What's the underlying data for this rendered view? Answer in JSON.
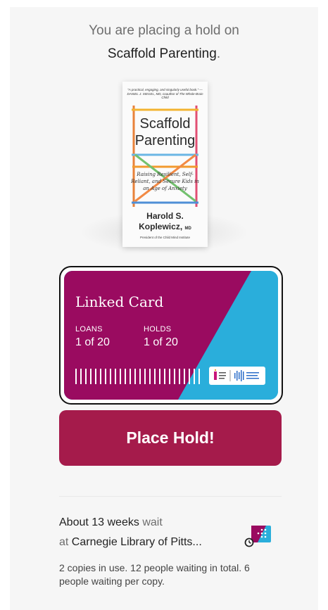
{
  "hold": {
    "intro": "You are placing a hold on",
    "title": "Scaffold Parenting",
    "title_punct": "."
  },
  "book_cover": {
    "quote": "\"A practical, engaging, and singularly useful book.\" —DANIEL J. SIEGEL, MD, coauthor of The Whole-Brain Child",
    "title_line1": "Scaffold",
    "title_line2": "Parenting",
    "subtitle": "Raising Resilient, Self-Reliant, and Secure Kids in an Age of Anxiety",
    "author_line1": "Harold S.",
    "author_line2": "Koplewicz,",
    "author_suffix": "MD",
    "institution": "President of the Child Mind Institute"
  },
  "card": {
    "name": "Linked Card",
    "loans_label": "LOANS",
    "loans_value": "1 of 20",
    "holds_label": "HOLDS",
    "holds_value": "1 of 20",
    "colors": {
      "magenta": "#9a0b60",
      "cyan": "#2aaedb"
    }
  },
  "actions": {
    "place_hold_label": "Place Hold!",
    "button_color": "#a51b4b"
  },
  "wait": {
    "estimate": "About 13 weeks",
    "estimate_suffix": "wait",
    "at_prefix": "at",
    "library": "Carnegie Library of Pitts...",
    "copies_info": "2 copies in use. 12 people waiting in total. 6 people waiting per copy.",
    "icon": "library-hold-badge-icon"
  }
}
